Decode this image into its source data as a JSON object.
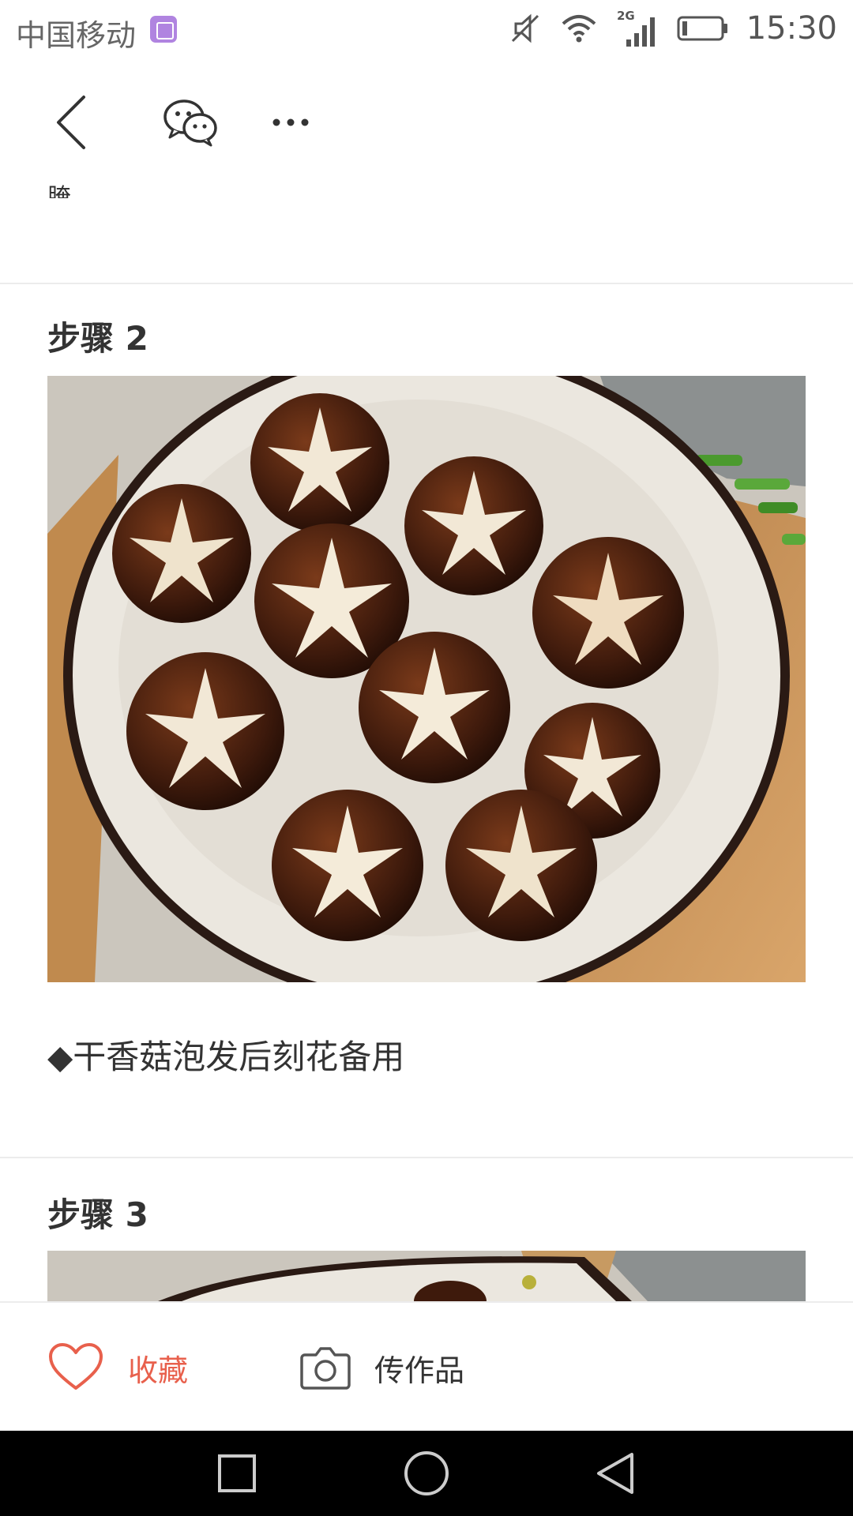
{
  "status_bar": {
    "carrier": "中国移动",
    "network": "2G",
    "time": "15:30"
  },
  "toolbar": {
    "icons": [
      "back-icon",
      "wechat-icon",
      "more-icon"
    ]
  },
  "content": {
    "clipped_text": "腌",
    "steps": [
      {
        "title": "步骤 2",
        "description": "◆干香菇泡发后刻花备用"
      },
      {
        "title": "步骤 3",
        "description": ""
      }
    ]
  },
  "action_bar": {
    "favorite_label": "收藏",
    "upload_label": "传作品"
  },
  "colors": {
    "accent": "#e8604c",
    "text": "#333333",
    "divider": "#ececec",
    "nav_bar": "#000000"
  }
}
